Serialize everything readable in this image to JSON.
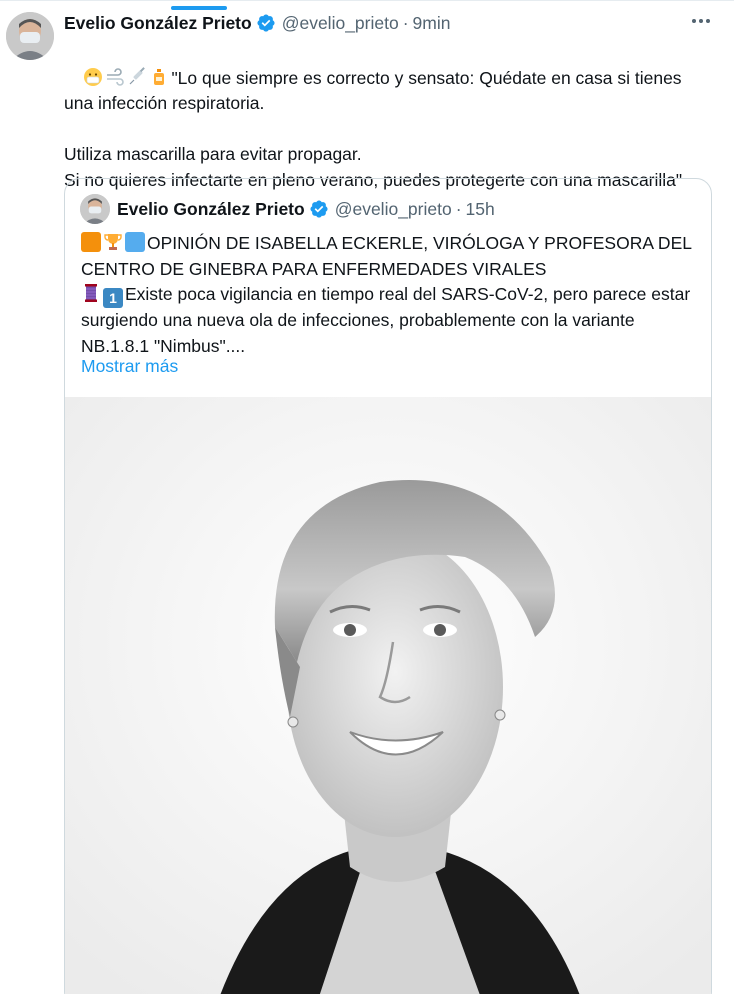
{
  "tweet": {
    "author_name": "Evelio González Prieto",
    "author_handle": "@evelio_prieto",
    "separator": "·",
    "time": "9min",
    "emoji_icons": [
      "mask-face-emoji",
      "wind-emoji",
      "syringe-emoji",
      "lotion-bottle-emoji"
    ],
    "text_line1": "\"Lo que siempre es correcto y sensato: Quédate en casa si tienes una infección respiratoria.",
    "text_line2": "Utiliza mascarilla para evitar propagar.",
    "text_line3": "Si no quieres infectarte en pleno verano, puedes protegerte con una mascarilla\""
  },
  "quote": {
    "author_name": "Evelio González Prieto",
    "author_handle": "@evelio_prieto",
    "separator": "·",
    "time": "15h",
    "heading_emoji_icons": [
      "orange-square-emoji",
      "trophy-emoji",
      "blue-square-emoji"
    ],
    "heading": "OPINIÓN DE ISABELLA ECKERLE, VIRÓLOGA Y PROFESORA DEL CENTRO DE GINEBRA PARA ENFERMEDADES VIRALES",
    "body_emoji_icons": [
      "thread-emoji",
      "keycap-1-emoji"
    ],
    "body": "Existe poca vigilancia en tiempo real del SARS-CoV-2, pero parece estar surgiendo una nueva ola de infecciones, probablemente con la variante NB.1.8.1 \"Nimbus\"....",
    "show_more": "Mostrar más"
  },
  "colors": {
    "accent": "#1d9bf0",
    "secondary_text": "#536471",
    "border": "#cfd9de"
  }
}
